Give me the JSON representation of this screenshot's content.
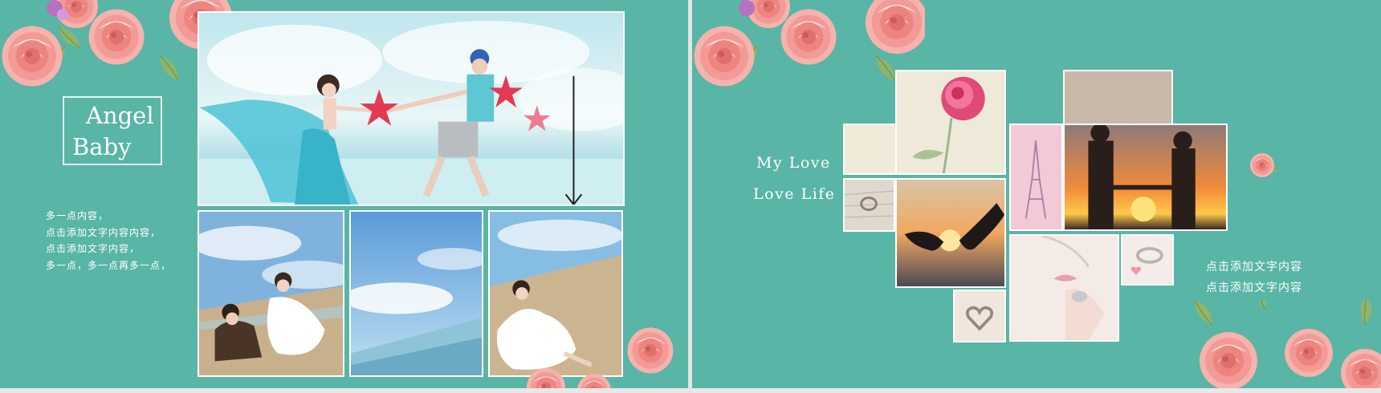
{
  "slide1": {
    "title_line1": "Angel",
    "title_line2": "Baby",
    "body_lines": [
      "多一点内容，",
      "点击添加文字内容内容，",
      "点击添加文字内容，",
      "多一点，多一点再多一点，"
    ]
  },
  "slide2": {
    "line1": "My  Love",
    "line2": "Love  Life",
    "side_lines": [
      "点击添加文字内容",
      "点击添加文字内容"
    ]
  },
  "colors": {
    "background": "#59b5a5",
    "text": "#ffffff",
    "rose": "#f08f8c"
  }
}
